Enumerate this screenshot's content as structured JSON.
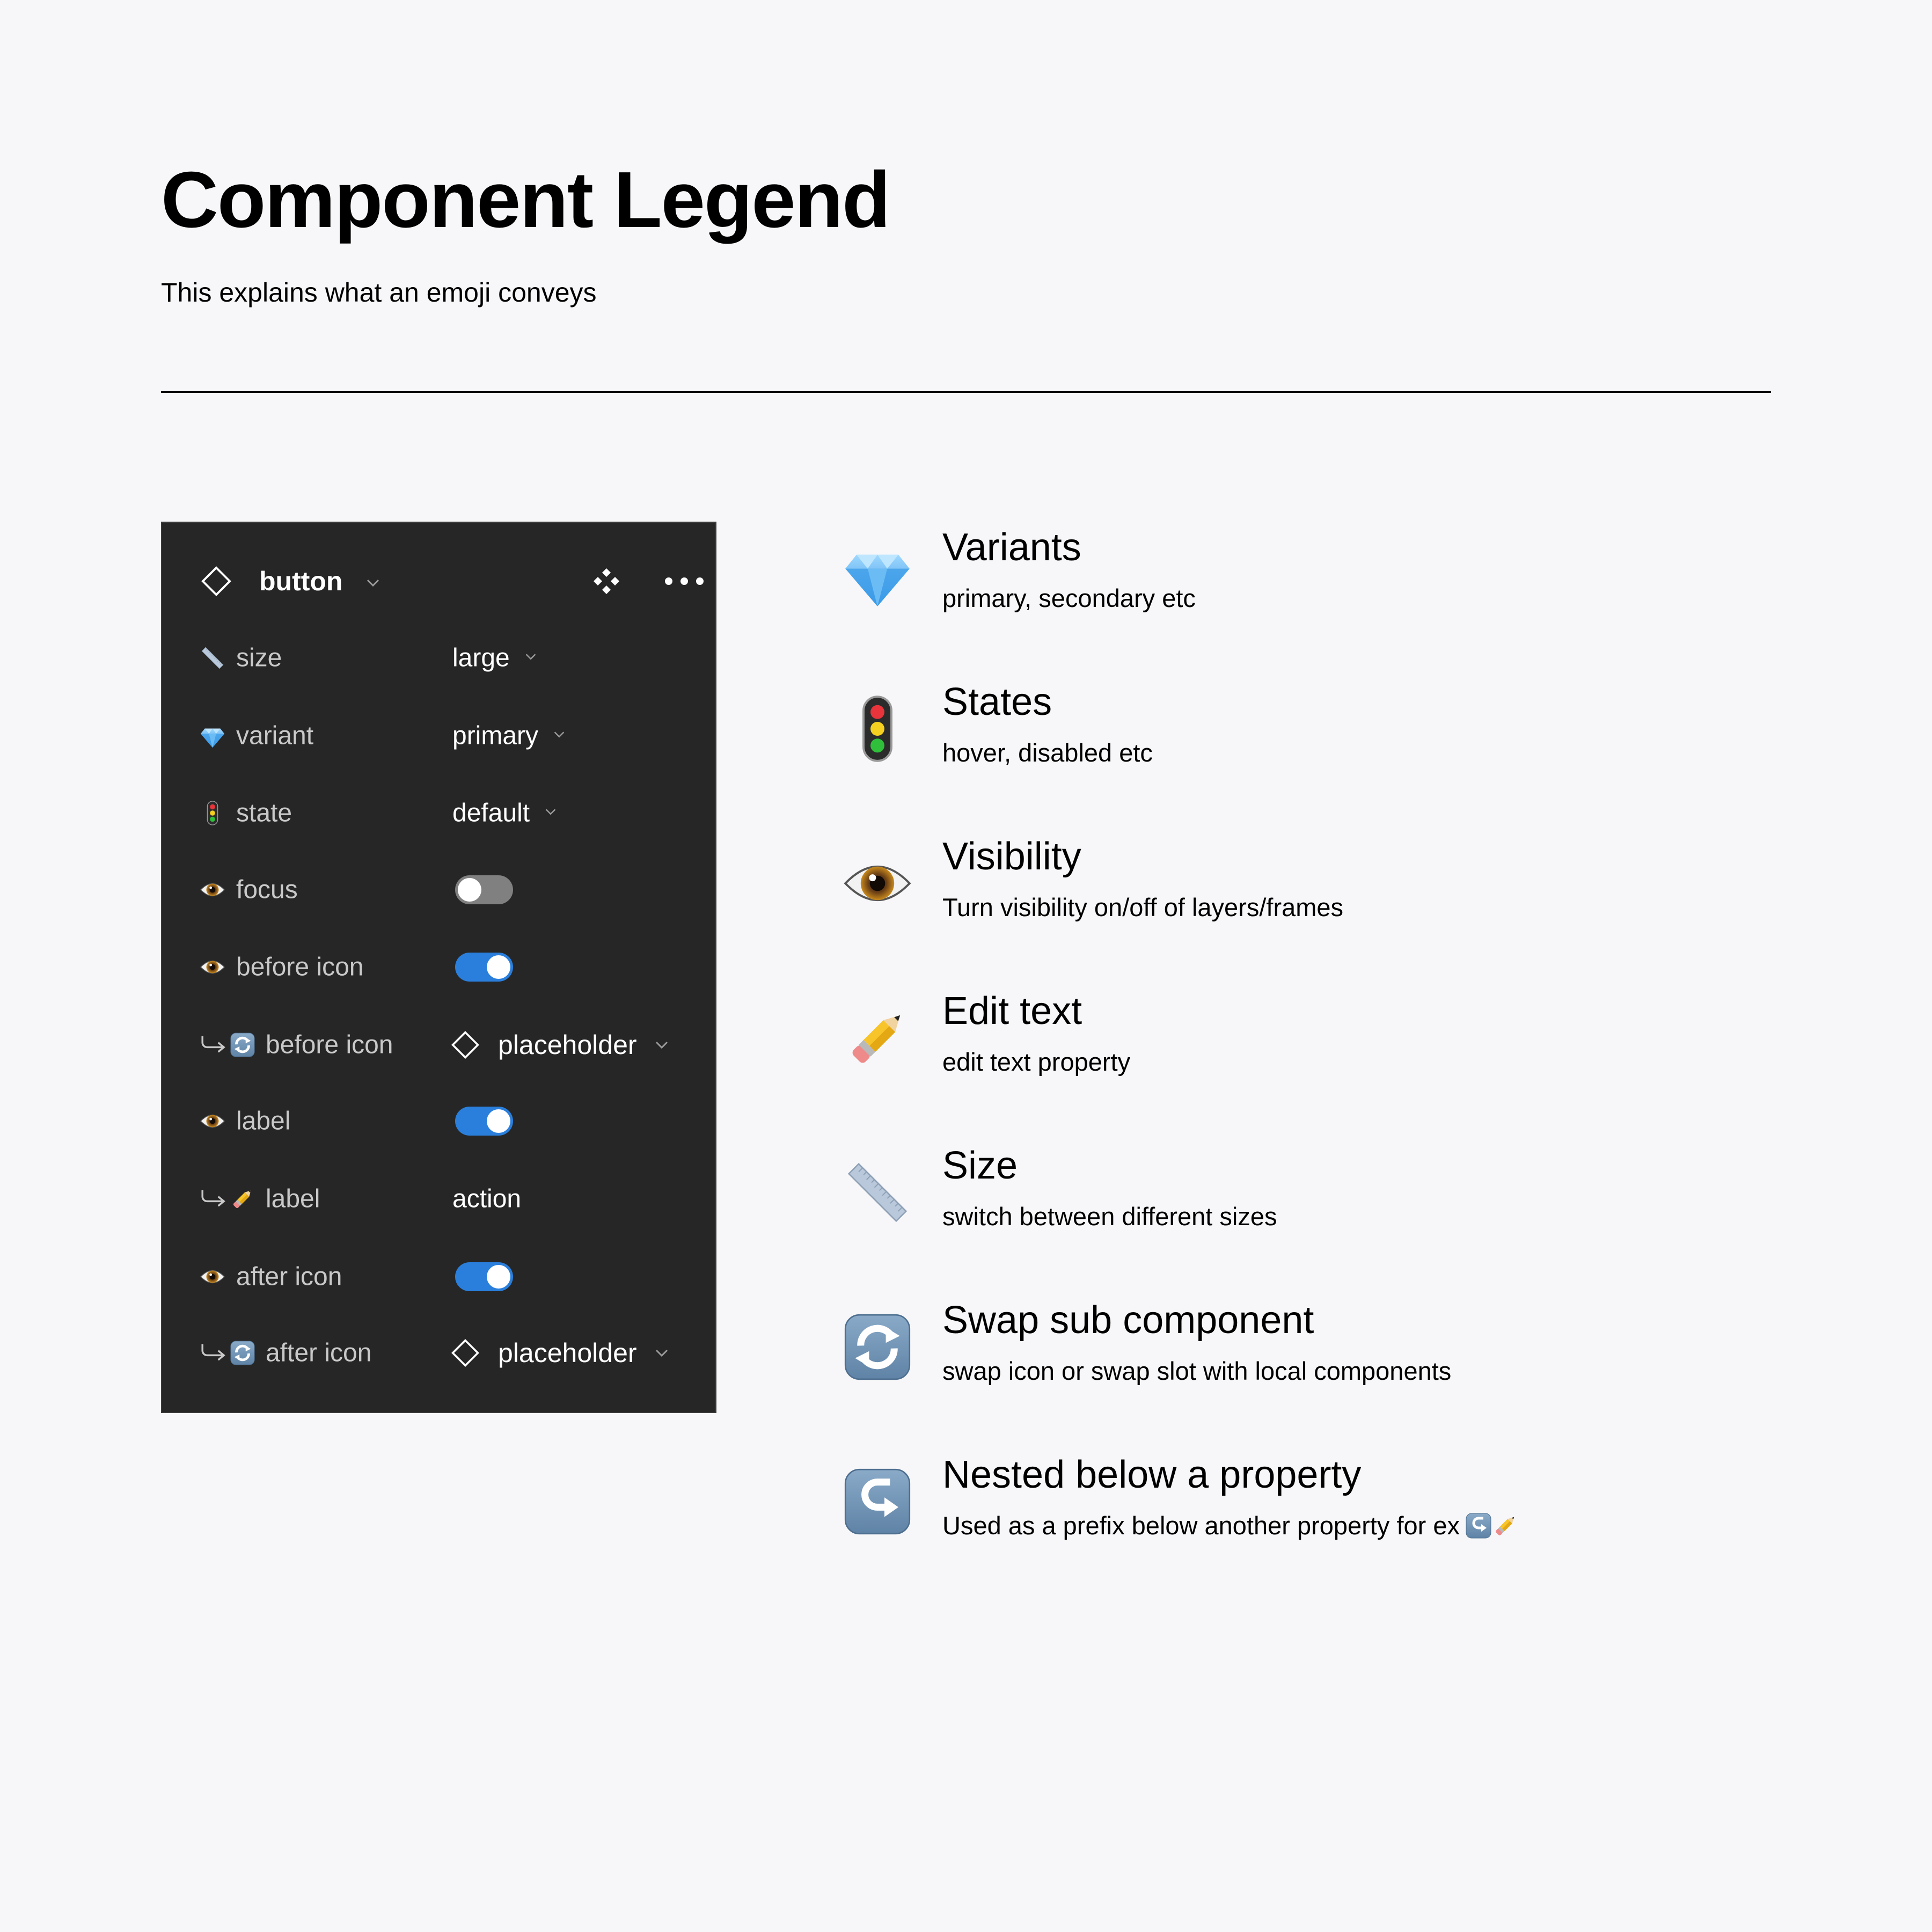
{
  "header": {
    "title": "Component Legend",
    "subtitle": "This explains what an emoji conveys"
  },
  "panel": {
    "component_name": "button",
    "component_icon": "diamond-outline-icon",
    "actions": [
      "component-set-icon",
      "more-icon"
    ],
    "rows": [
      {
        "icon": "ruler-icon",
        "label": "size",
        "type": "dropdown",
        "value": "large"
      },
      {
        "icon": "gem-icon",
        "label": "variant",
        "type": "dropdown",
        "value": "primary"
      },
      {
        "icon": "traffic-light-icon",
        "label": "state",
        "type": "dropdown",
        "value": "default"
      },
      {
        "icon": "eye-icon",
        "label": "focus",
        "type": "toggle",
        "on": false
      },
      {
        "icon": "eye-icon",
        "label": "before icon",
        "type": "toggle",
        "on": true
      },
      {
        "icon": "swap-icon",
        "nested": true,
        "label": "before icon",
        "type": "instance",
        "value": "placeholder"
      },
      {
        "icon": "eye-icon",
        "label": "label",
        "type": "toggle",
        "on": true
      },
      {
        "icon": "pencil-icon",
        "nested": true,
        "label": "label",
        "type": "text",
        "value": "action"
      },
      {
        "icon": "eye-icon",
        "label": "after icon",
        "type": "toggle",
        "on": true
      },
      {
        "icon": "swap-icon",
        "nested": true,
        "label": "after icon",
        "type": "instance",
        "value": "placeholder"
      }
    ]
  },
  "legend": [
    {
      "icon": "gem-icon",
      "title": "Variants",
      "description": "primary, secondary etc"
    },
    {
      "icon": "traffic-light-icon",
      "title": "States",
      "description": "hover, disabled etc"
    },
    {
      "icon": "eye-icon",
      "title": "Visibility",
      "description": "Turn visibility on/off of layers/frames"
    },
    {
      "icon": "pencil-icon",
      "title": "Edit text",
      "description": "edit text property"
    },
    {
      "icon": "ruler-icon",
      "title": "Size",
      "description": "switch between different sizes"
    },
    {
      "icon": "swap-icon",
      "title": "Swap sub component",
      "description": "swap icon or swap slot with local components"
    },
    {
      "icon": "nested-arrow-icon",
      "title": "Nested below a property",
      "description": "Used as a prefix below another property for ex",
      "example_icons": [
        "nested-arrow-icon",
        "pencil-icon"
      ]
    }
  ],
  "colors": {
    "background": "#f7f7f9",
    "panel_bg": "#262626",
    "panel_label": "#c9c9c9",
    "panel_value": "#ffffff",
    "toggle_on": "#2a7fdc",
    "toggle_off": "#808080",
    "text": "#000000"
  }
}
